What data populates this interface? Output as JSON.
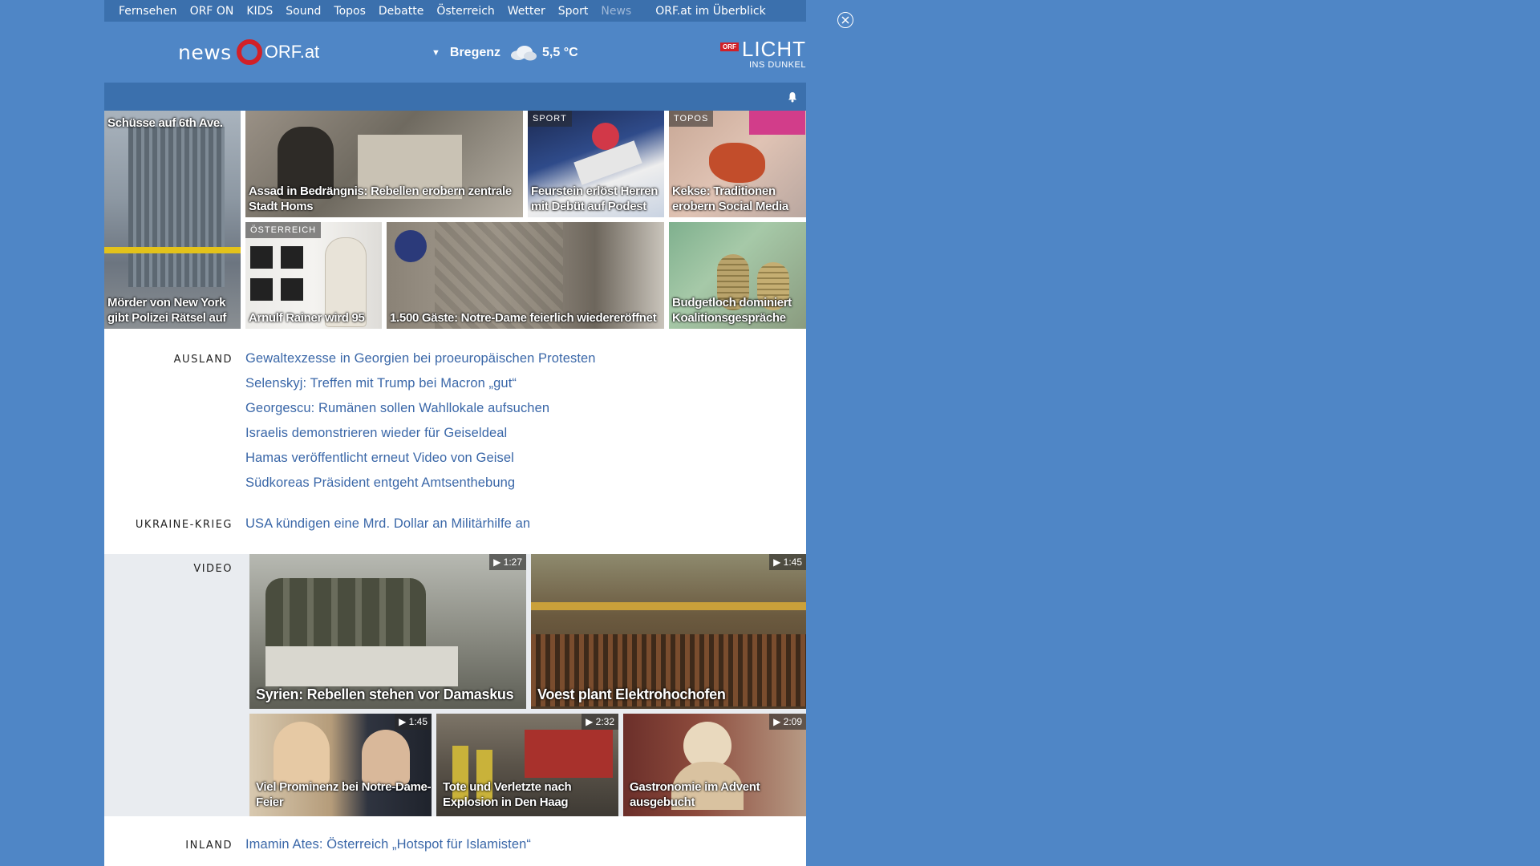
{
  "topnav": {
    "items": [
      "Fernsehen",
      "ORF ON",
      "KIDS",
      "Sound",
      "Topos",
      "Debatte",
      "Österreich",
      "Wetter",
      "Sport",
      "News"
    ],
    "overview": "ORF.at im Überblick"
  },
  "header": {
    "logo_news": "news",
    "logo_orf": "ORF.at",
    "weather_city": "Bregenz",
    "weather_temp": "5,5 °C",
    "licht_badge": "ORF",
    "licht_title": "LICHT",
    "licht_sub": "INS DUNKEL"
  },
  "tiles": [
    {
      "tag": "",
      "title": "Schüsse auf 6th Ave.",
      "caption": "Mörder von New York gibt Polizei Rätsel auf"
    },
    {
      "tag": "",
      "caption": "Assad in Bedrängnis: Rebellen erobern zentrale Stadt Homs"
    },
    {
      "tag": "SPORT",
      "caption": "Feurstein erlöst Herren mit Debüt auf Podest"
    },
    {
      "tag": "TOPOS",
      "caption": "Kekse: Traditionen erobern Social Media"
    },
    {
      "tag": "ÖSTERREICH",
      "caption": "Arnulf Rainer wird 95"
    },
    {
      "tag": "",
      "caption": "1.500 Gäste: Notre-Dame feierlich wiedereröffnet"
    },
    {
      "tag": "",
      "caption": "Budgetloch dominiert Koalitionsgespräche"
    }
  ],
  "sections": {
    "ausland": {
      "label": "AUSLAND",
      "links": [
        "Gewaltexzesse in Georgien bei proeuropäischen Protesten",
        "Selenskyj: Treffen mit Trump bei Macron „gut“",
        "Georgescu: Rumänen sollen Wahllokale aufsuchen",
        "Israelis demonstrieren wieder für Geiseldeal",
        "Hamas veröffentlicht erneut Video von Geisel",
        "Südkoreas Präsident entgeht Amtsenthebung"
      ]
    },
    "ukraine": {
      "label": "UKRAINE-KRIEG",
      "links": [
        "USA kündigen eine Mrd. Dollar an Militärhilfe an"
      ]
    },
    "video": {
      "label": "VIDEO",
      "items": [
        {
          "duration": "1:27",
          "caption": "Syrien: Rebellen stehen vor Damaskus"
        },
        {
          "duration": "1:45",
          "caption": "Voest plant Elektrohochofen"
        },
        {
          "duration": "1:45",
          "caption": "Viel Prominenz bei Notre-Dame-Feier"
        },
        {
          "duration": "2:32",
          "caption": "Tote und Verletzte nach Explosion in Den Haag"
        },
        {
          "duration": "2:09",
          "caption": "Gastronomie im Advent ausgebucht"
        }
      ]
    },
    "inland": {
      "label": "INLAND",
      "links": [
        "Imamin Ates: Österreich „Hotspot für Islamisten“"
      ]
    }
  },
  "colors": {
    "background": "#4f86c6",
    "nav_bar": "#3b70ad",
    "link": "#3a67a8",
    "orf_red": "#d22027"
  }
}
